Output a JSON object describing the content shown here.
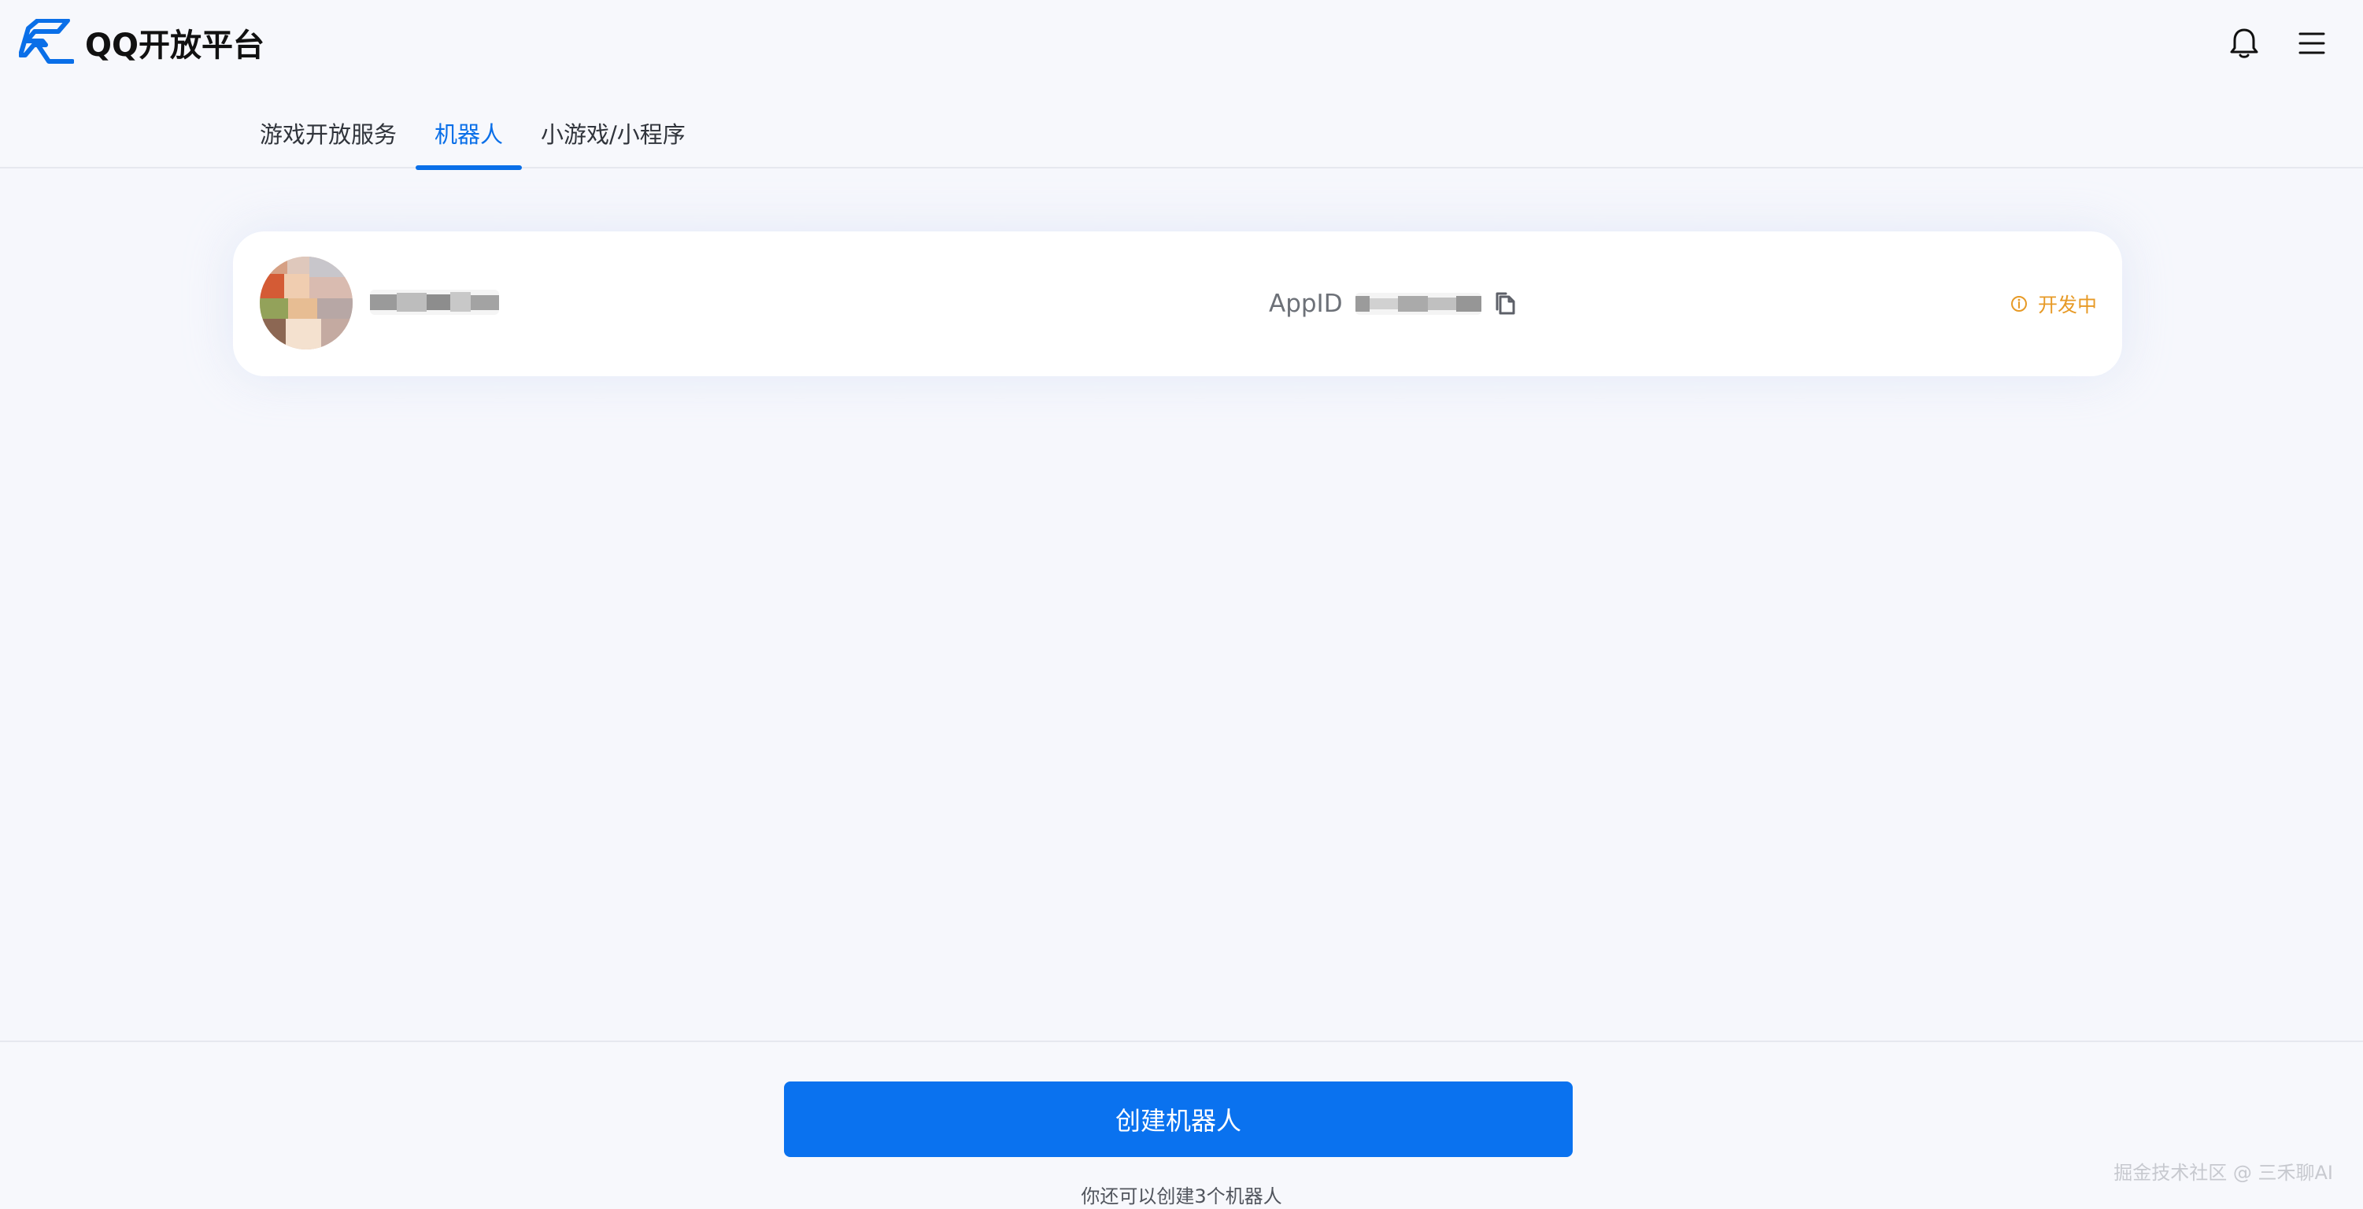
{
  "brand": {
    "name": "QQ开放平台",
    "logo_icon": "qq-open-platform-logo",
    "accent_color": "#0A6FE8"
  },
  "header": {
    "notification_icon": "bell-icon",
    "menu_icon": "menu-icon",
    "tabs": [
      {
        "label": "游戏开放服务",
        "active": false
      },
      {
        "label": "机器人",
        "active": true
      },
      {
        "label": "小游戏/小程序",
        "active": false
      }
    ]
  },
  "bot": {
    "appid_label": "AppID",
    "copy_icon": "copy-icon",
    "status_icon": "info-circle-icon",
    "status": "开发中",
    "status_color": "#E79A26"
  },
  "footer": {
    "create_button": "创建机器人",
    "remaining_text": "你还可以创建3个机器人"
  },
  "watermark": "掘金技术社区 @ 三禾聊AI"
}
